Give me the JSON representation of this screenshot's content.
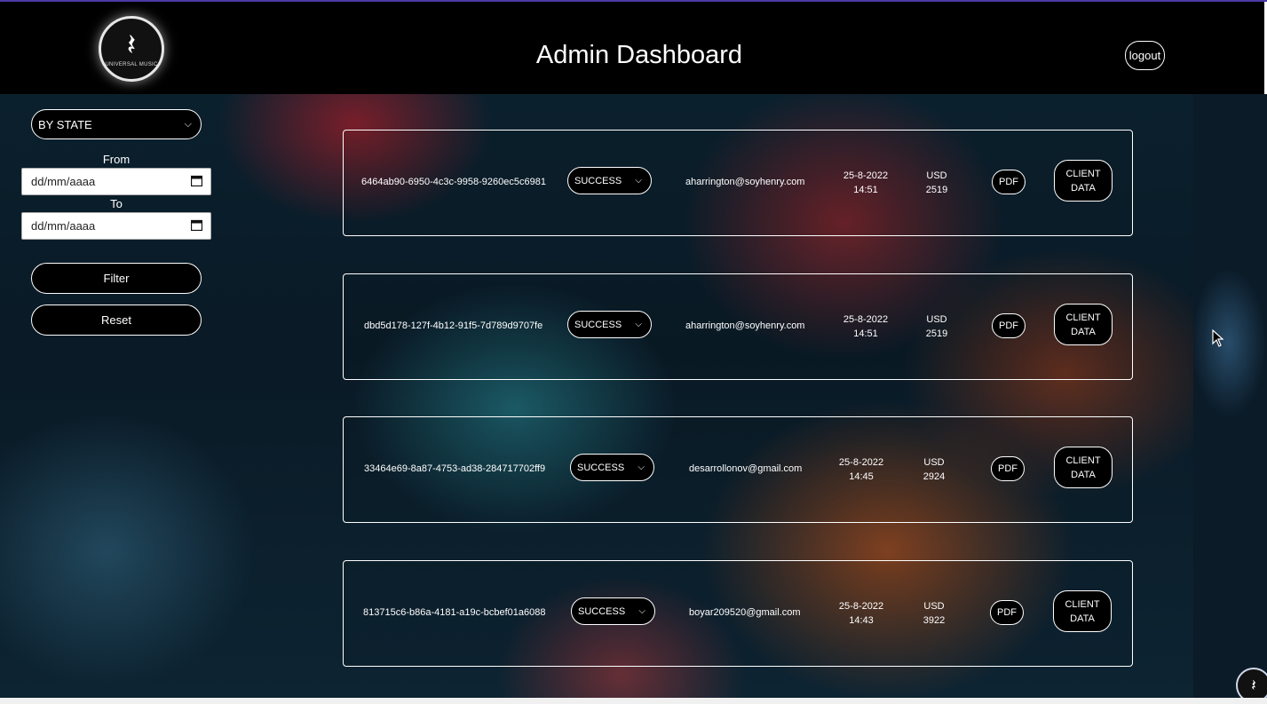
{
  "header": {
    "logo_text": "UNIVERSAL MUSIC",
    "title": "Admin Dashboard",
    "logout_label": "logout"
  },
  "sidebar": {
    "state_select": "BY STATE",
    "from_label": "From",
    "from_placeholder": "dd/mm/aaaa",
    "to_label": "To",
    "to_placeholder": "dd/mm/aaaa",
    "filter_label": "Filter",
    "reset_label": "Reset"
  },
  "orders": [
    {
      "id": "6464ab90-6950-4c3c-9958-9260ec5c6981",
      "status": "SUCCESS",
      "email": "aharrington@soyhenry.com",
      "date": "25-8-2022",
      "time": "14:51",
      "currency": "USD",
      "amount": "2519",
      "pdf_label": "PDF",
      "client_line1": "CLIENT",
      "client_line2": "DATA"
    },
    {
      "id": "dbd5d178-127f-4b12-91f5-7d789d9707fe",
      "status": "SUCCESS",
      "email": "aharrington@soyhenry.com",
      "date": "25-8-2022",
      "time": "14:51",
      "currency": "USD",
      "amount": "2519",
      "pdf_label": "PDF",
      "client_line1": "CLIENT",
      "client_line2": "DATA"
    },
    {
      "id": "33464e69-8a87-4753-ad38-284717702ff9",
      "status": "SUCCESS",
      "email": "desarrollonov@gmail.com",
      "date": "25-8-2022",
      "time": "14:45",
      "currency": "USD",
      "amount": "2924",
      "pdf_label": "PDF",
      "client_line1": "CLIENT",
      "client_line2": "DATA"
    },
    {
      "id": "813715c6-b86a-4181-a19c-bcbef01a6088",
      "status": "SUCCESS",
      "email": "boyar209520@gmail.com",
      "date": "25-8-2022",
      "time": "14:43",
      "currency": "USD",
      "amount": "3922",
      "pdf_label": "PDF",
      "client_line1": "CLIENT",
      "client_line2": "DATA"
    }
  ]
}
